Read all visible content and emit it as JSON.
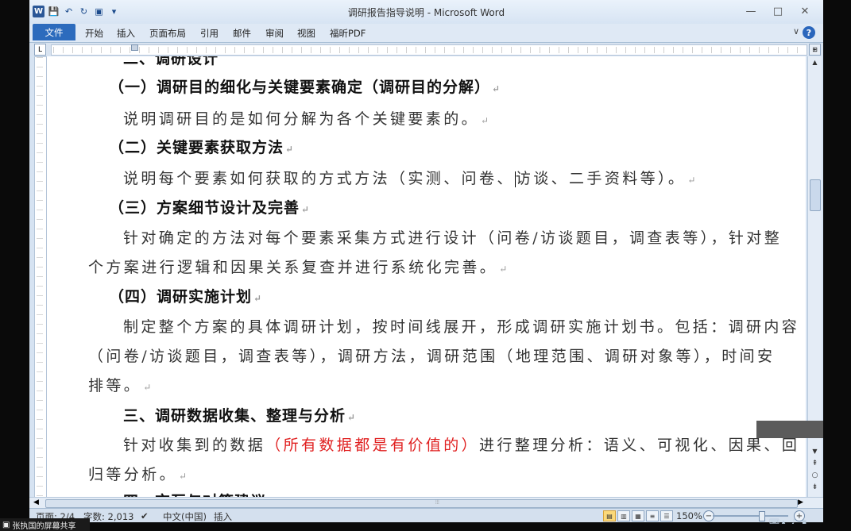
{
  "window": {
    "title": "调研报告指导说明 - Microsoft Word",
    "controls": {
      "minimize": "—",
      "maximize": "□",
      "close": "✕"
    }
  },
  "quick_access": {
    "logo": "W",
    "save_icon": "💾",
    "undo_icon": "↶",
    "redo_icon": "↻",
    "print_icon": "▣",
    "customize_icon": "▾"
  },
  "ribbon": {
    "tabs": [
      "文件",
      "开始",
      "插入",
      "页面布局",
      "引用",
      "邮件",
      "审阅",
      "视图",
      "福昕PDF"
    ],
    "help": "?",
    "minimize_icon": "∨"
  },
  "ruler": {
    "tab_selector": "L",
    "view_ruler_icon": "⊞"
  },
  "document": {
    "clipped_top": "二、调研设计",
    "paragraphs": [
      {
        "type": "h",
        "text": "（一）调研目的细化与关键要素确定（调研目的分解）"
      },
      {
        "type": "body",
        "text": "说明调研目的是如何分解为各个关键要素的。"
      },
      {
        "type": "h",
        "text": "（二）关键要素获取方法"
      },
      {
        "type": "body_cursor",
        "before": "说明每个要素如何获取的方式方法（实测、问卷、",
        "after": "访谈、二手资料等）。"
      },
      {
        "type": "h",
        "text": "（三）方案细节设计及完善"
      },
      {
        "type": "body",
        "text": "针对确定的方法对每个要素采集方式进行设计（问卷/访谈题目，调查表等），针对整"
      },
      {
        "type": "body",
        "text": "个方案进行逻辑和因果关系复查并进行系统化完善。"
      },
      {
        "type": "h",
        "text": "（四）调研实施计划"
      },
      {
        "type": "body",
        "text": "制定整个方案的具体调研计划，按时间线展开，形成调研实施计划书。包括：调研内容"
      },
      {
        "type": "body",
        "text": "（问卷/访谈题目，调查表等），调研方法，调研范围（地理范围、调研对象等），时间安"
      },
      {
        "type": "body",
        "text": "排等。"
      },
      {
        "type": "h",
        "text": "三、调研数据收集、整理与分析"
      },
      {
        "type": "body_red",
        "before": "针对收集到的数据",
        "red": "（所有数据都是有价值的）",
        "after": "进行整理分析：语义、可视化、因果、回"
      },
      {
        "type": "body",
        "text": "归等分析。"
      }
    ],
    "clipped_bottom": "四、交互与对策建议"
  },
  "statusbar": {
    "page": "页面: 2/4",
    "words": "字数: 2,013",
    "language": "中文(中国)",
    "mode": "插入",
    "zoom": "150%",
    "zoom_level_percent": 150
  },
  "screen_share": {
    "label": "张执国的屏幕共享"
  }
}
